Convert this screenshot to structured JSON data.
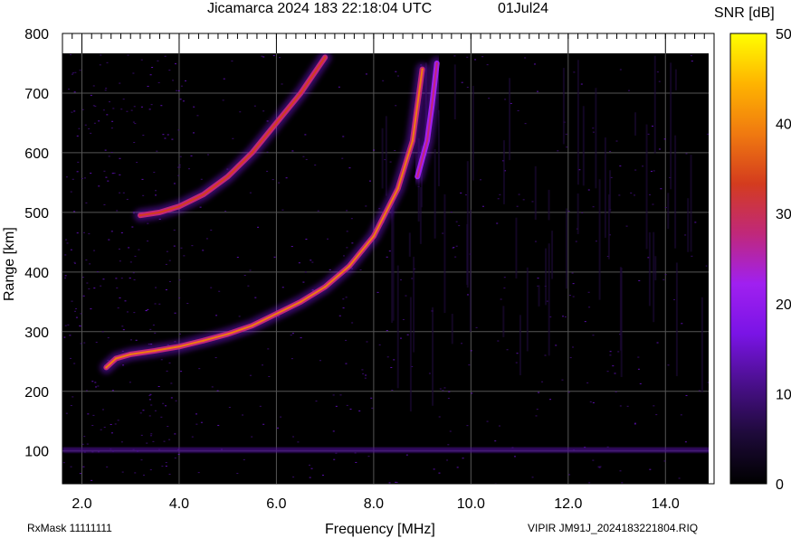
{
  "header": {
    "title": "Jicamarca 2024 183 22:18:04 UTC",
    "date": "01Jul24"
  },
  "footer": {
    "left": "RxMask 11111111",
    "right": "VIPIR  JM91J_2024183221804.RIQ"
  },
  "colors": {
    "background": "#000000",
    "grid": "#555555",
    "colormap": [
      "#000000",
      "#1e0a3a",
      "#4a0f8c",
      "#7a14e6",
      "#a020f0",
      "#c0287a",
      "#d43c1e",
      "#f07a10",
      "#ffb400",
      "#ffff00"
    ]
  },
  "chart_data": {
    "type": "heatmap",
    "title": "Jicamarca 2024 183 22:18:04 UTC",
    "xlabel": "Frequency [MHz]",
    "ylabel": "Range [km]",
    "xlim": [
      1.6,
      15.0
    ],
    "ylim": [
      45,
      800
    ],
    "x_ticks": [
      2.0,
      4.0,
      6.0,
      8.0,
      10.0,
      12.0,
      14.0
    ],
    "x_tick_labels": [
      "2.0",
      "4.0",
      "6.0",
      "8.0",
      "10.0",
      "12.0",
      "14.0"
    ],
    "y_ticks": [
      100,
      200,
      300,
      400,
      500,
      600,
      700,
      800
    ],
    "y_tick_labels": [
      "100",
      "200",
      "300",
      "400",
      "500",
      "600",
      "700",
      "800"
    ],
    "grid": true,
    "colorbar": {
      "label": "SNR [dB]",
      "range": [
        0,
        50
      ],
      "ticks": [
        0,
        10,
        20,
        30,
        40,
        50
      ],
      "tick_labels": [
        "0",
        "10",
        "20",
        "30",
        "40",
        "50"
      ]
    },
    "traces": [
      {
        "x": [
          2.5,
          2.7,
          3.0,
          3.5,
          4.0,
          4.5,
          5.0,
          5.5,
          6.0,
          6.5,
          7.0,
          7.5,
          8.0,
          8.5,
          8.8,
          9.0
        ],
        "y": [
          240,
          255,
          262,
          268,
          275,
          285,
          296,
          310,
          330,
          350,
          375,
          410,
          460,
          540,
          620,
          740
        ],
        "snr": 38
      },
      {
        "x": [
          3.2,
          3.6,
          4.0,
          4.5,
          5.0,
          5.5,
          6.0,
          6.5,
          7.0
        ],
        "y": [
          495,
          500,
          510,
          530,
          560,
          600,
          650,
          700,
          760
        ],
        "snr": 36
      },
      {
        "x": [
          8.9,
          9.1,
          9.2,
          9.3
        ],
        "y": [
          560,
          620,
          680,
          750
        ],
        "snr": 30
      }
    ],
    "interference_band": {
      "range_km": 100,
      "freq_mhz": [
        1.6,
        15.0
      ],
      "snr": 12
    }
  }
}
